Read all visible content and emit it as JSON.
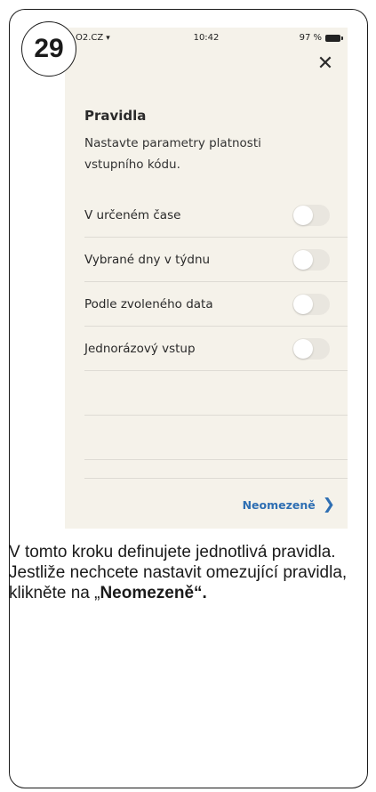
{
  "step": {
    "number": "29"
  },
  "status_bar": {
    "carrier": "O2.CZ",
    "time": "10:42",
    "battery": "97 %"
  },
  "screen": {
    "title": "Pravidla",
    "subtitle": "Nastavte parametry platnosti vstupního kódu.",
    "rules": [
      {
        "label": "V určeném čase",
        "enabled": false
      },
      {
        "label": "Vybrané dny v týdnu",
        "enabled": false
      },
      {
        "label": "Podle zvoleného data",
        "enabled": false
      },
      {
        "label": "Jednorázový vstup",
        "enabled": false
      }
    ],
    "unlimited_label": "Neomezeně"
  },
  "instruction": {
    "text": "V tomto kroku definujete jednotlivá pravidla. Jestliže nechcete nastavit omezující pravidla, klikněte na „",
    "highlight": "Neomezeně“."
  },
  "colors": {
    "accent": "#2f6fb3",
    "screen_bg": "#f5f2ea",
    "toggle_off": "#e9e6df"
  },
  "icons": {
    "close": "close-icon",
    "chevron": "chevron-right-icon",
    "wifi": "wifi-icon",
    "battery": "battery-icon"
  }
}
